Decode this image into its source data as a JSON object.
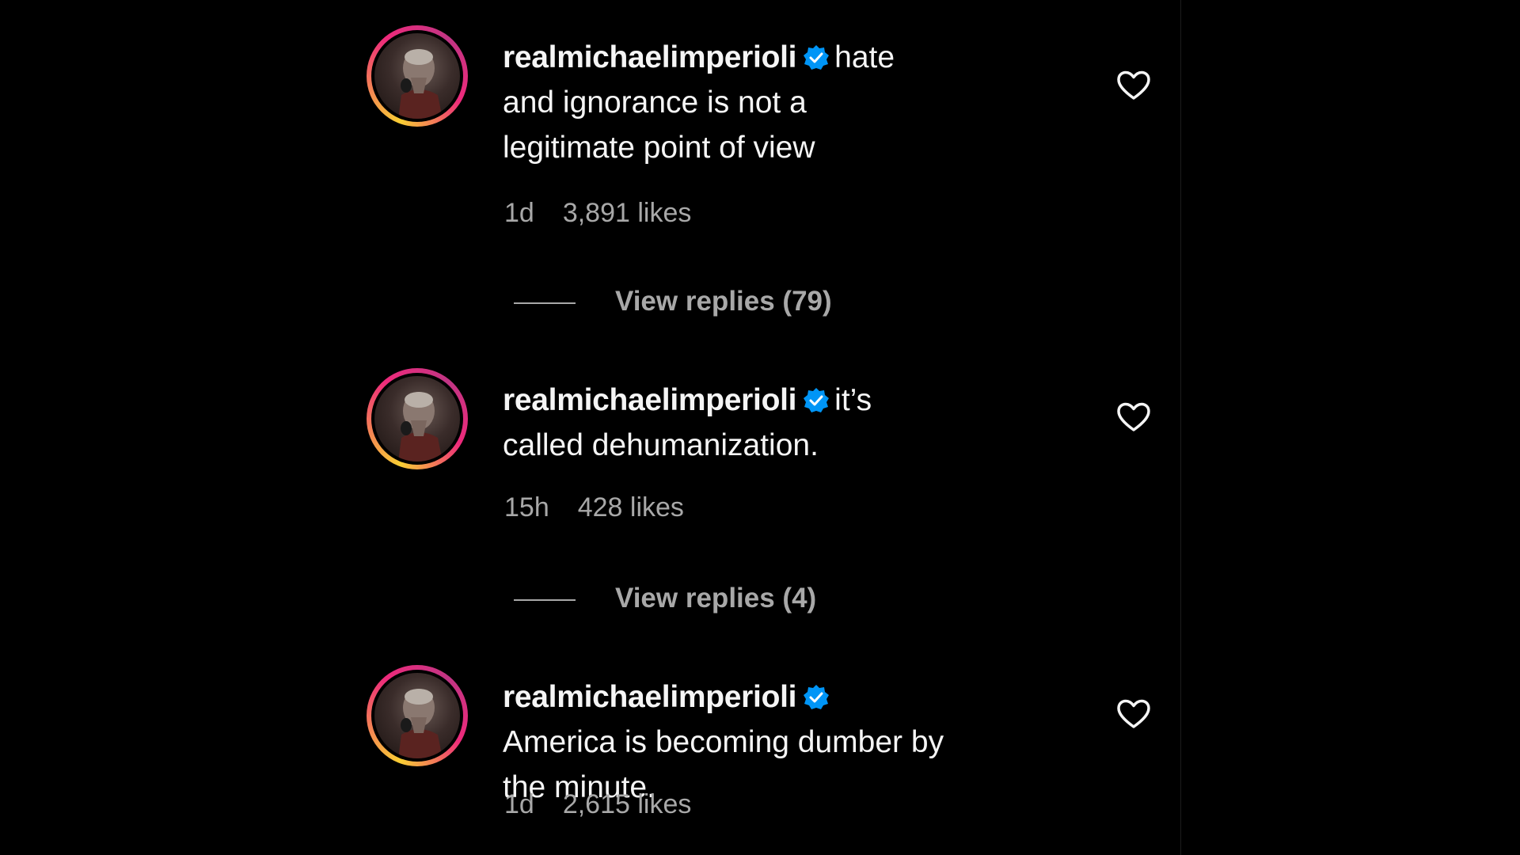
{
  "comments": [
    {
      "username": "realmichaelimperioli",
      "text": "hate and ignorance is not a legitimate point of view",
      "time": "1d",
      "likes": "3,891 likes",
      "replies": "View replies (79)"
    },
    {
      "username": "realmichaelimperioli",
      "text": "it’s called dehumanization.",
      "time": "15h",
      "likes": "428 likes",
      "replies": "View replies (4)"
    },
    {
      "username": "realmichaelimperioli",
      "text": "America is becoming dumber by the minute.",
      "time": "1d",
      "likes": "2,615 likes"
    }
  ],
  "icons": {
    "verified": "verified-badge-icon",
    "like": "heart-icon"
  },
  "colors": {
    "background": "#000000",
    "text": "#f5f5f5",
    "secondary_text": "#a8a8a8",
    "verified_blue": "#0095f6"
  }
}
